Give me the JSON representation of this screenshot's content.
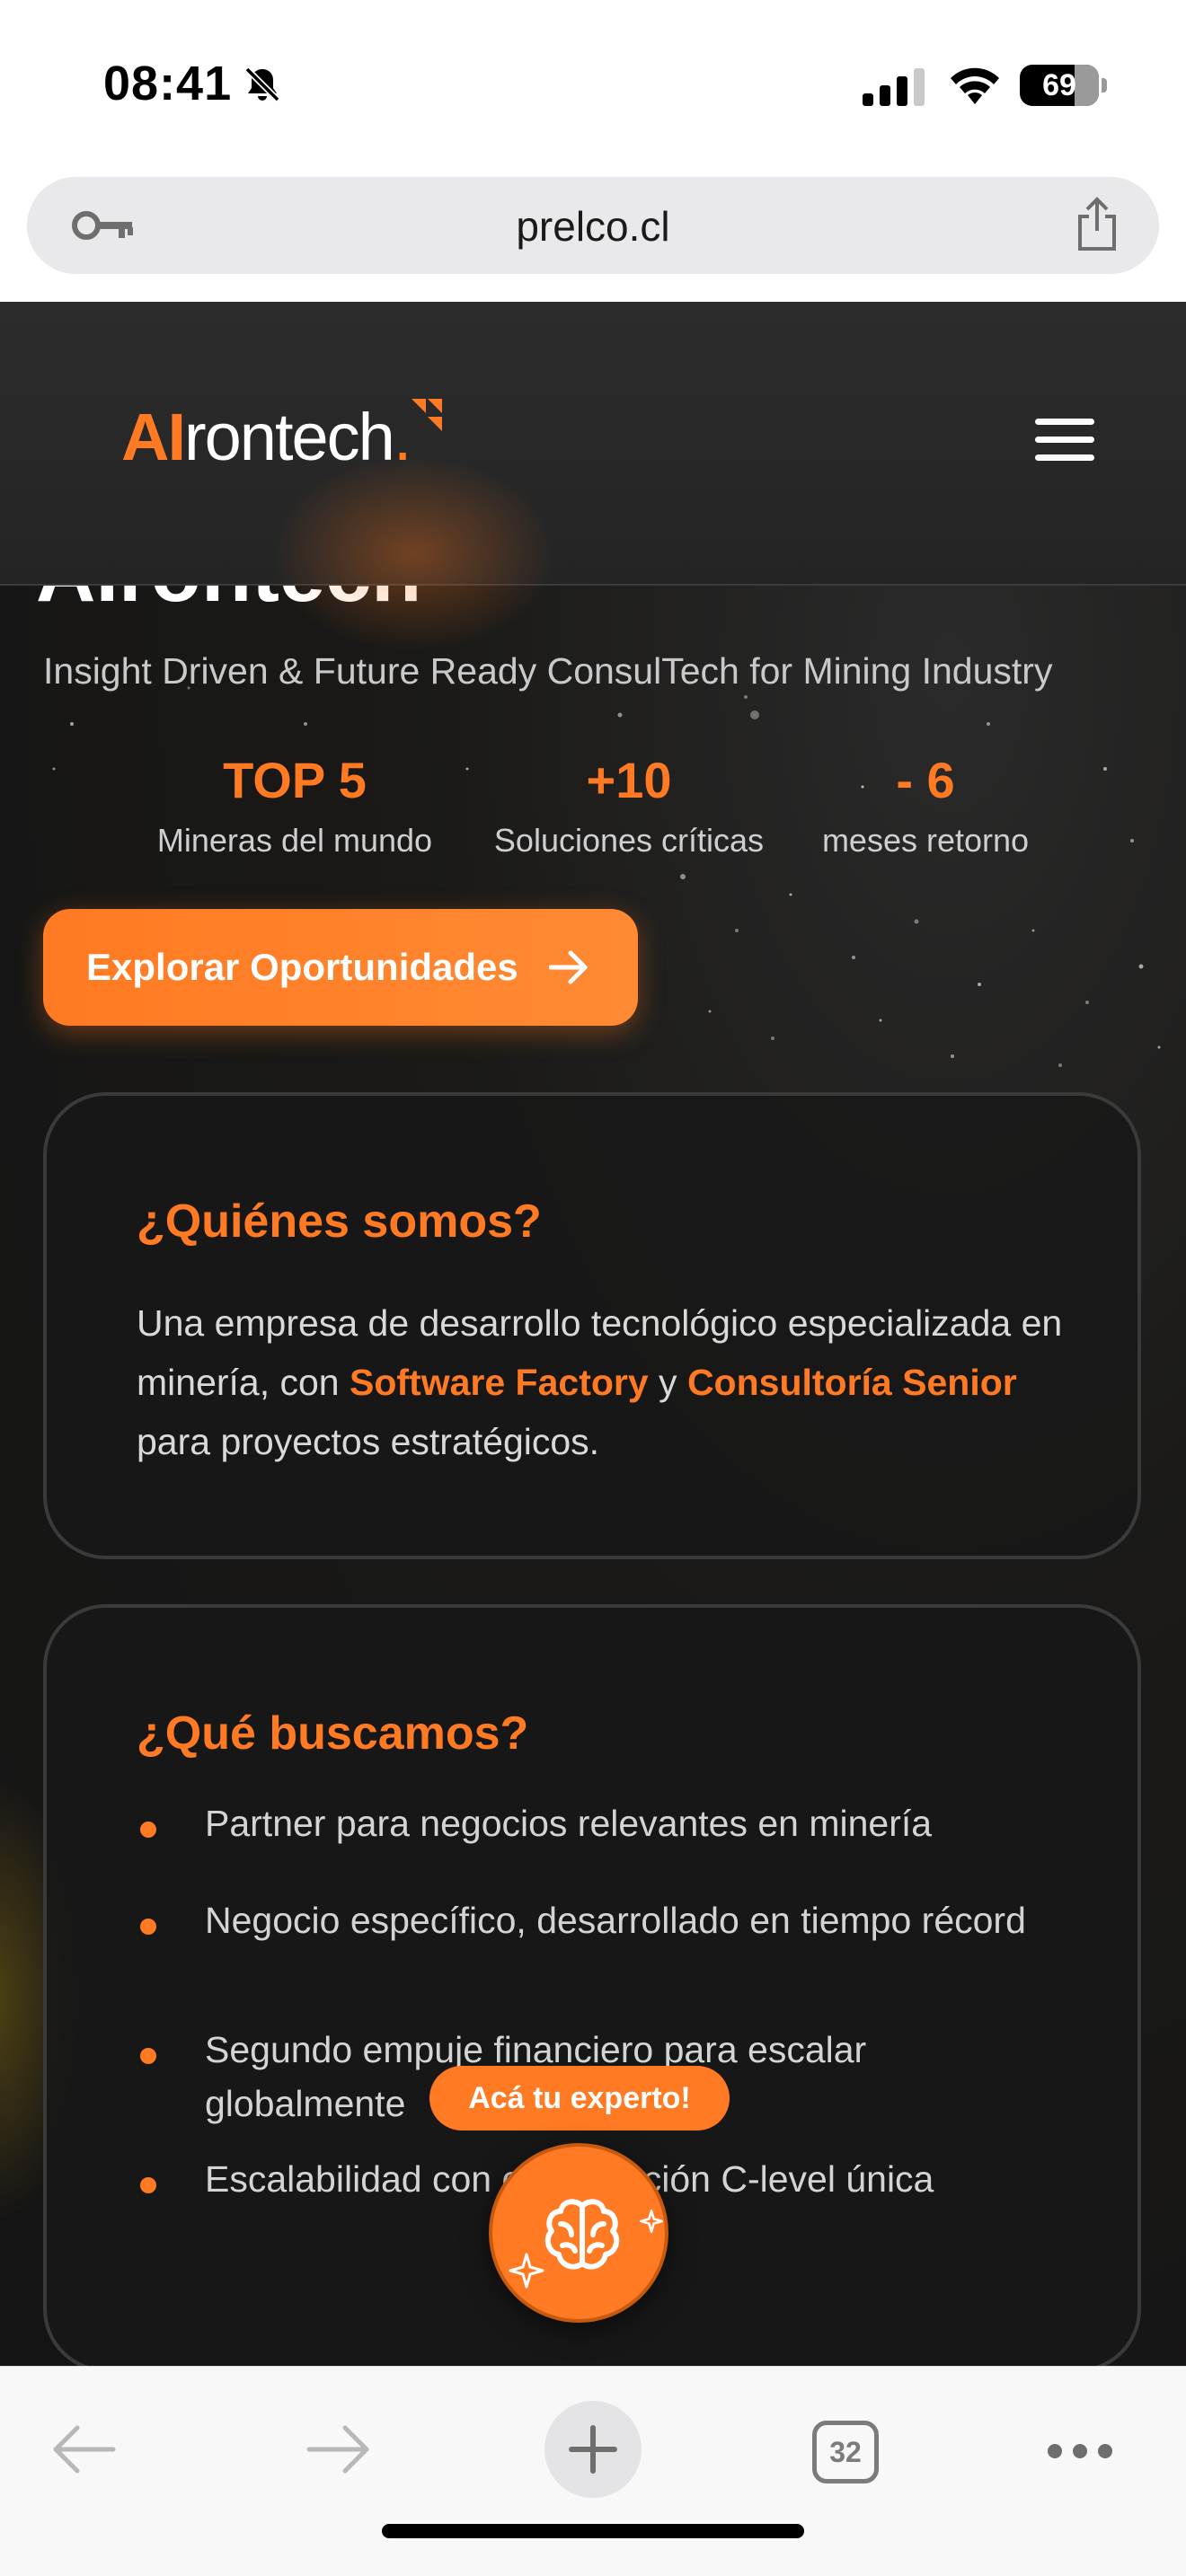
{
  "status_bar": {
    "time": "08:41",
    "battery": "69",
    "battery_level": 0.69
  },
  "browser": {
    "url": "prelco.cl",
    "tab_count": "32"
  },
  "site": {
    "logo": {
      "ai": "AI",
      "rest": "rontech",
      "dot": "."
    },
    "hero_title_fragment": "AIrontech",
    "tagline": "Insight Driven & Future Ready ConsulTech for Mining Industry",
    "stats": [
      {
        "value": "TOP 5",
        "label": "Mineras del mundo"
      },
      {
        "value": "+10",
        "label": "Soluciones críticas"
      },
      {
        "value": "- 6",
        "label": "meses retorno"
      }
    ],
    "cta_label": "Explorar Oportunidades",
    "about": {
      "title": "¿Quiénes somos?",
      "text_1": "Una empresa de desarrollo tecnológico especializada en minería, con ",
      "highlight_1": "Software Factory",
      "text_2": " y ",
      "highlight_2": "Consultoría Senior",
      "text_3": " para proyectos estratégicos."
    },
    "seek": {
      "title": "¿Qué buscamos?",
      "items": [
        "Partner para negocios relevantes en minería",
        "Negocio específico, desarrollado en tiempo récord",
        "Segundo empuje financiero para escalar globalmente",
        "Escalabilidad con organización C-level única"
      ]
    },
    "expert_badge": "Acá tu experto!"
  },
  "colors": {
    "accent": "#ff7a22",
    "background": "#141414",
    "card_border": "#3a3a3a"
  },
  "icons": [
    "bell-slash-icon",
    "signal-icon",
    "wifi-icon",
    "key-icon",
    "share-icon",
    "menu-icon",
    "arrow-right-icon",
    "brain-icon",
    "sparkle-icon",
    "back-arrow-icon",
    "forward-arrow-icon",
    "plus-icon",
    "more-icon"
  ]
}
